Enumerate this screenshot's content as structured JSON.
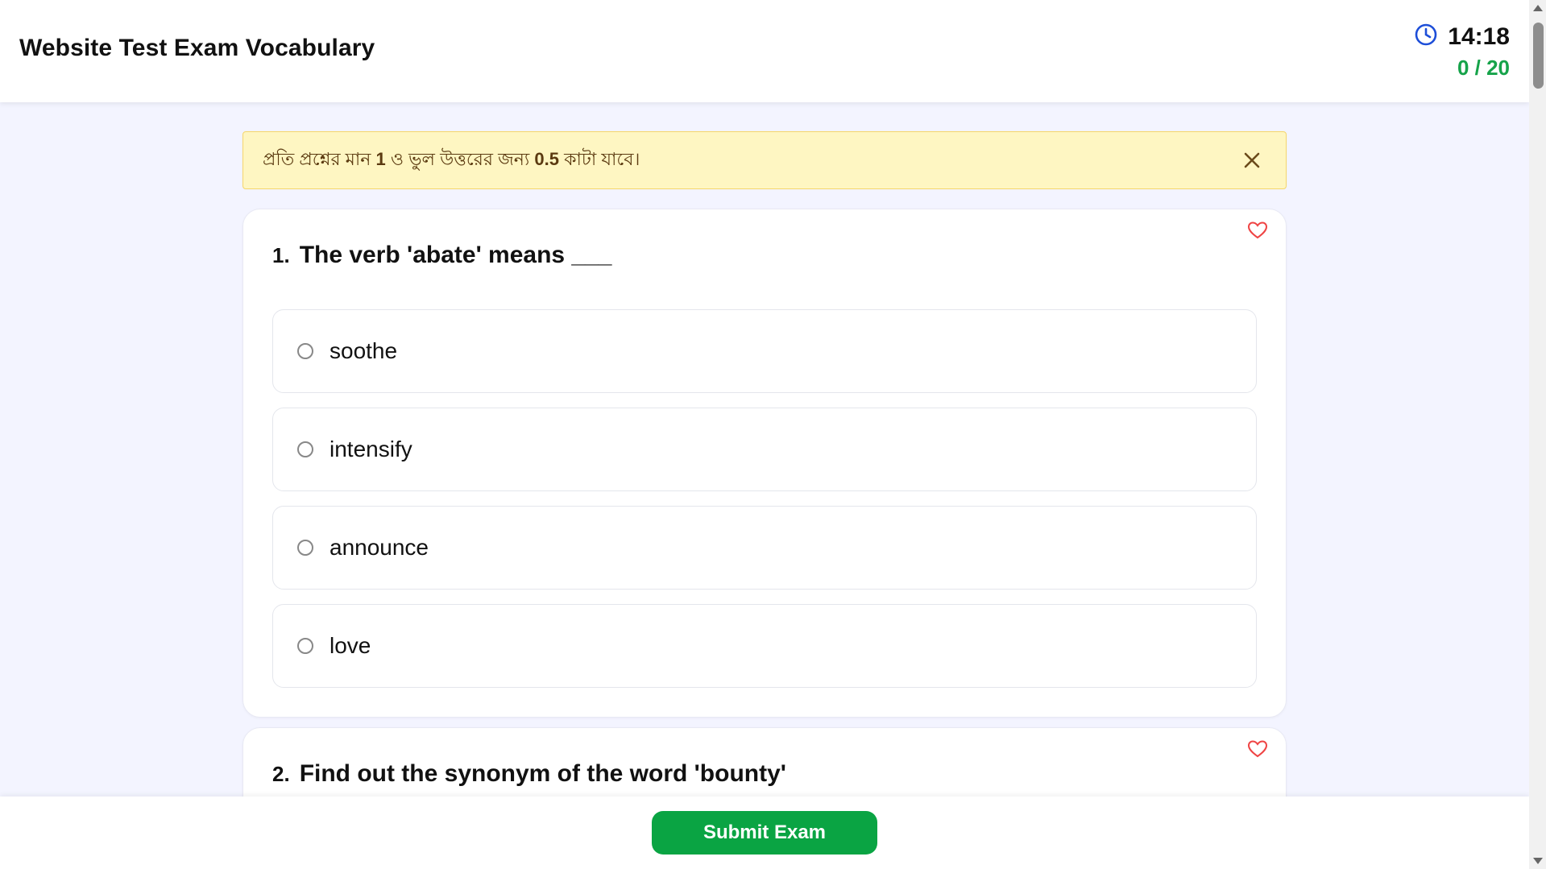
{
  "header": {
    "title": "Website Test Exam Vocabulary",
    "timer": "14:18",
    "score": "0 / 20",
    "timer_icon": "clock-icon"
  },
  "notice": {
    "text_before": "প্রতি প্রশ্নের মান ",
    "mark": "1",
    "text_middle": " ও ভুল উত্তরের জন্য ",
    "negative": "0.5",
    "text_after": " কাটা যাবে।",
    "close_icon": "close-icon"
  },
  "questions": [
    {
      "number": "1.",
      "text": "The verb 'abate' means ___",
      "options": [
        "soothe",
        "intensify",
        "announce",
        "love"
      ]
    },
    {
      "number": "2.",
      "text": "Find out the synonym of the word 'bounty'"
    }
  ],
  "footer": {
    "submit_label": "Submit Exam"
  },
  "colors": {
    "accent_green": "#0aa443",
    "score_green": "#16a34a",
    "clock_blue": "#1d4ed8",
    "heart_red": "#ef4444",
    "notice_bg": "#fef6c2"
  }
}
